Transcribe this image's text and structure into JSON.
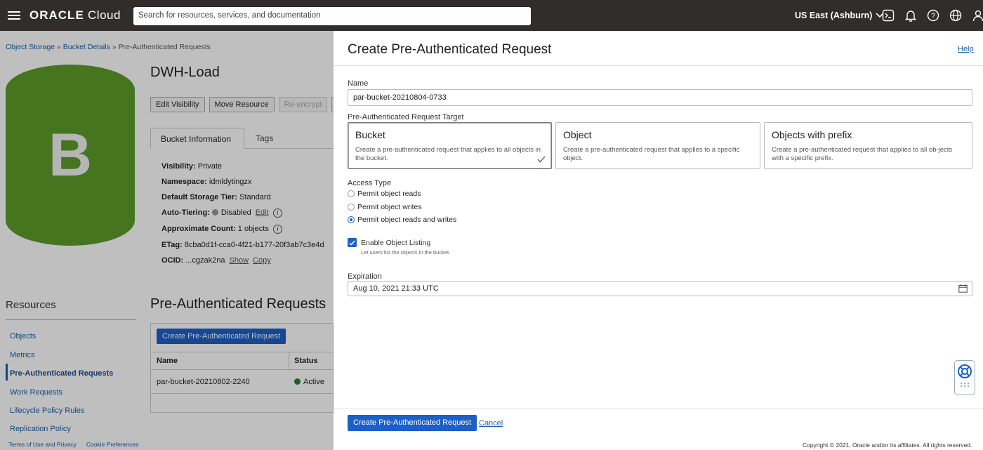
{
  "topbar": {
    "logo_brand": "ORACLE",
    "logo_product": "Cloud",
    "search_placeholder": "Search for resources, services, and documentation",
    "region": "US East (Ashburn)"
  },
  "breadcrumb": {
    "items": [
      "Object Storage",
      "Bucket Details",
      "Pre-Authenticated Requests"
    ],
    "separator": "»"
  },
  "bucket": {
    "icon_letter": "B",
    "icon_color": "#5c9c2a",
    "name": "DWH-Load",
    "buttons": [
      "Edit Visibility",
      "Move Resource",
      "Re-encrypt",
      "A"
    ],
    "tabs": [
      "Bucket Information",
      "Tags"
    ],
    "info": {
      "visibility_label": "Visibility:",
      "visibility_value": "Private",
      "namespace_label": "Namespace:",
      "namespace_value": "idmldytingzx",
      "storage_tier_label": "Default Storage Tier:",
      "storage_tier_value": "Standard",
      "auto_tiering_label": "Auto-Tiering:",
      "auto_tiering_value": "Disabled",
      "auto_tiering_edit": "Edit",
      "count_label": "Approximate Count:",
      "count_value": "1 objects",
      "etag_label": "ETag:",
      "etag_value": "8cba0d1f-cca0-4f21-b177-20f3ab7c3e4d",
      "ocid_label": "OCID:",
      "ocid_value": "...cgzak2na",
      "ocid_show": "Show",
      "ocid_copy": "Copy"
    }
  },
  "resources": {
    "title": "Resources",
    "items": [
      "Objects",
      "Metrics",
      "Pre-Authenticated Requests",
      "Work Requests",
      "Lifecycle Policy Rules",
      "Replication Policy"
    ],
    "active_index": 2
  },
  "par_section": {
    "title": "Pre-Authenticated Requests",
    "create_button": "Create Pre-Authenticated Request",
    "columns": [
      "Name",
      "Status"
    ],
    "rows": [
      {
        "name": "par-bucket-20210802-2240",
        "status": "Active"
      }
    ]
  },
  "footer": {
    "terms": "Terms of Use and Privacy",
    "cookies": "Cookie Preferences",
    "copyright": "Copyright © 2021, Oracle and/or its affiliates. All rights reserved."
  },
  "panel": {
    "title": "Create Pre-Authenticated Request",
    "help": "Help",
    "name_label": "Name",
    "name_value": "par-bucket-20210804-0733",
    "target_label": "Pre-Authenticated Request Target",
    "targets": [
      {
        "title": "Bucket",
        "desc": "Create a pre-authenticated request that applies to all objects in the bucket.",
        "selected": true
      },
      {
        "title": "Object",
        "desc": "Create a pre-authenticated request that applies to a specific object.",
        "selected": false
      },
      {
        "title": "Objects with prefix",
        "desc": "Create a pre-authenticated request that applies to all ob-jects with a specific prefix.",
        "selected": false
      }
    ],
    "access_label": "Access Type",
    "access_options": [
      "Permit object reads",
      "Permit object writes",
      "Permit object reads and writes"
    ],
    "access_selected_index": 2,
    "listing_label": "Enable Object Listing",
    "listing_help": "Let users list the objects in the bucket.",
    "listing_checked": true,
    "expiration_label": "Expiration",
    "expiration_value": "Aug 10, 2021 21:33 UTC",
    "submit": "Create Pre-Authenticated Request",
    "cancel": "Cancel"
  },
  "colors": {
    "topbar": "#312d2a",
    "primary_button": "#1c5fc7",
    "link": "#1a5fa8",
    "active_status": "#2e7d32"
  }
}
